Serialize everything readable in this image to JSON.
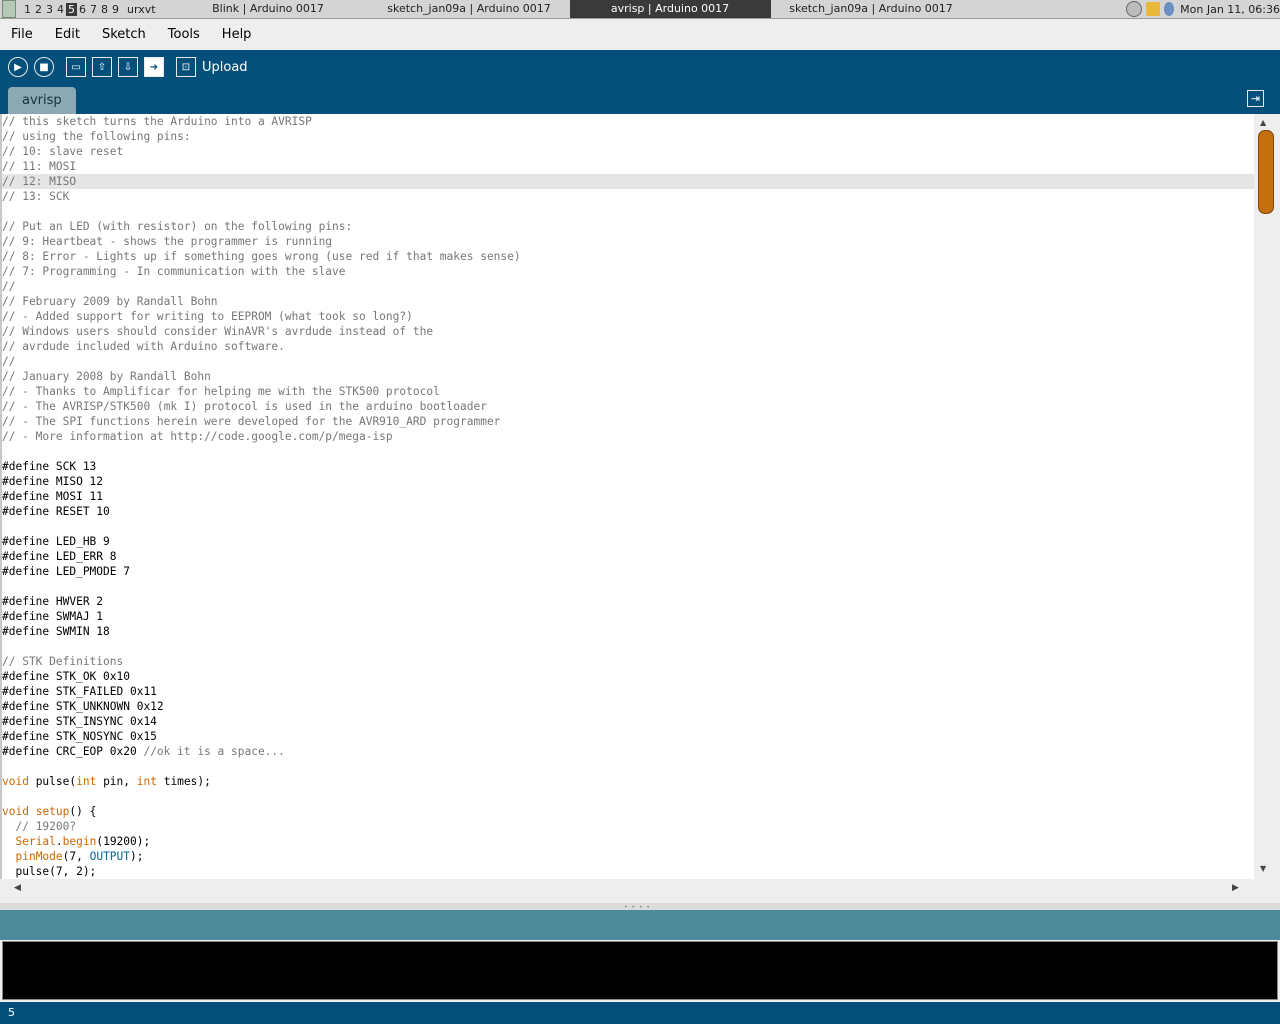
{
  "taskbar": {
    "workspaces": [
      "1",
      "2",
      "3",
      "4",
      "5",
      "6",
      "7",
      "8",
      "9"
    ],
    "active_workspace": "5",
    "terminal_label": "urxvt",
    "tasks": [
      {
        "title": "Blink | Arduino 0017",
        "active": false
      },
      {
        "title": "sketch_jan09a | Arduino 0017",
        "active": false
      },
      {
        "title": "avrisp | Arduino 0017",
        "active": true
      },
      {
        "title": "sketch_jan09a | Arduino 0017",
        "active": false
      }
    ],
    "clock": "Mon Jan 11, 06:36"
  },
  "menubar": {
    "items": [
      "File",
      "Edit",
      "Sketch",
      "Tools",
      "Help"
    ]
  },
  "toolbar": {
    "buttons": [
      "verify",
      "stop",
      "new",
      "open",
      "save",
      "upload",
      "serial-monitor"
    ],
    "status_label": "Upload"
  },
  "tabs": [
    {
      "label": "avrisp",
      "active": true
    }
  ],
  "editor": {
    "highlighted_line": 5,
    "lines": [
      "// this sketch turns the Arduino into a AVRISP",
      "// using the following pins:",
      "// 10: slave reset",
      "// 11: MOSI",
      "// 12: MISO",
      "// 13: SCK",
      "",
      "// Put an LED (with resistor) on the following pins:",
      "// 9: Heartbeat - shows the programmer is running",
      "// 8: Error - Lights up if something goes wrong (use red if that makes sense)",
      "// 7: Programming - In communication with the slave",
      "//",
      "// February 2009 by Randall Bohn",
      "// - Added support for writing to EEPROM (what took so long?)",
      "// Windows users should consider WinAVR's avrdude instead of the",
      "// avrdude included with Arduino software.",
      "//",
      "// January 2008 by Randall Bohn",
      "// - Thanks to Amplificar for helping me with the STK500 protocol",
      "// - The AVRISP/STK500 (mk I) protocol is used in the arduino bootloader",
      "// - The SPI functions herein were developed for the AVR910_ARD programmer",
      "// - More information at http://code.google.com/p/mega-isp",
      "",
      "#define SCK 13",
      "#define MISO 12",
      "#define MOSI 11",
      "#define RESET 10",
      "",
      "#define LED_HB 9",
      "#define LED_ERR 8",
      "#define LED_PMODE 7",
      "",
      "#define HWVER 2",
      "#define SWMAJ 1",
      "#define SWMIN 18",
      "",
      "// STK Definitions",
      "#define STK_OK 0x10",
      "#define STK_FAILED 0x11",
      "#define STK_UNKNOWN 0x12",
      "#define STK_INSYNC 0x14",
      "#define STK_NOSYNC 0x15",
      "#define CRC_EOP 0x20 //ok it is a space...",
      "",
      "void pulse(int pin, int times);",
      "",
      "void setup() {",
      "  // 19200?",
      "  Serial.begin(19200);",
      "  pinMode(7, OUTPUT);",
      "  pulse(7, 2);"
    ]
  },
  "message_area": {
    "text": ""
  },
  "console": {
    "text": ""
  },
  "status_bar": {
    "line_number": "5"
  },
  "colors": {
    "toolbar_bg": "#04507a",
    "message_bar_bg": "#4f8a9b",
    "tab_bg": "#8ca8b3",
    "keyword": "#cc6600",
    "constant": "#006699",
    "comment": "#777777",
    "scroll_thumb": "#c4700e"
  }
}
